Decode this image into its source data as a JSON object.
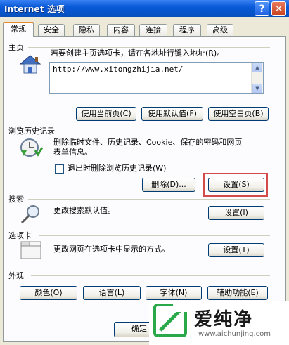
{
  "window": {
    "title": "Internet 选项",
    "help_label": "?",
    "close_label": "✕"
  },
  "tabs": [
    "常规",
    "安全",
    "隐私",
    "内容",
    "连接",
    "程序",
    "高级"
  ],
  "home": {
    "section_label": "主页",
    "description": "若要创建主页选项卡，请在各地址行键入地址(R)。",
    "url_value": "http://www.xitongzhijia.net/",
    "buttons": [
      "使用当前页(C)",
      "使用默认值(F)",
      "使用空白页(B)"
    ]
  },
  "history": {
    "section_label": "浏览历史记录",
    "description_line1": "删除临时文件、历史记录、Cookie、保存的密码和网页",
    "description_line2": "表单信息。",
    "checkbox_label": "退出时删除浏览历史记录(W)",
    "checkbox_checked": false,
    "delete_label": "删除(D)...",
    "settings_label": "设置(S)"
  },
  "search": {
    "section_label": "搜索",
    "description": "更改搜索默认值。",
    "settings_label": "设置(I)"
  },
  "tabs_section": {
    "section_label": "选项卡",
    "description": "更改网页在选项卡中显示的方式。",
    "settings_label": "设置(T)"
  },
  "appearance": {
    "section_label": "外观",
    "buttons": [
      "颜色(O)",
      "语言(L)",
      "字体(N)",
      "辅助功能(E)"
    ]
  },
  "footer": {
    "ok_label": "确定"
  },
  "watermark": {
    "text": "爱纯净",
    "url": "www.aichunjing.com"
  },
  "colors": {
    "title_bar": "#0653c6",
    "dialog_bg": "#ece9d8",
    "panel_bg": "#fcfcfe",
    "highlight_box": "#d24a4a"
  }
}
